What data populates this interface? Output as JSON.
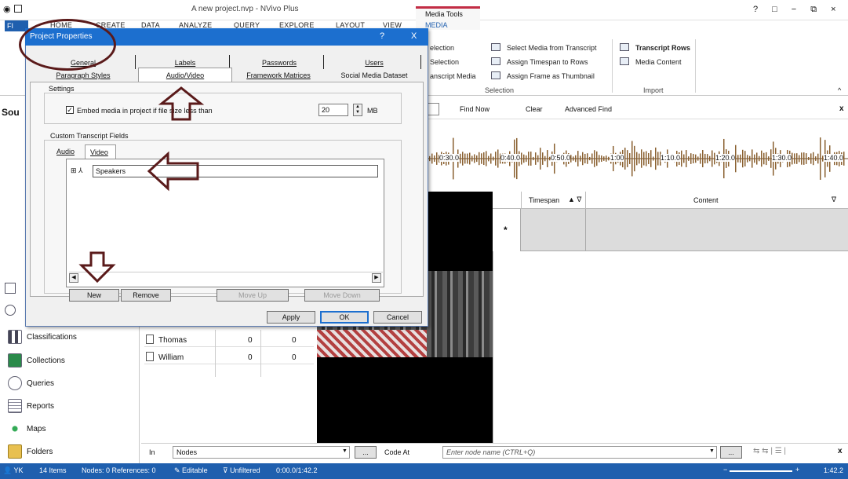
{
  "app": {
    "title": "A new project.nvp - NVivo Plus",
    "window_controls": [
      "?",
      "□",
      "−",
      "⧉",
      "×"
    ]
  },
  "ribbon": {
    "file_tab": "FI",
    "tabs": [
      "HOME",
      "CREATE",
      "DATA",
      "ANALYZE",
      "QUERY",
      "EXPLORE",
      "LAYOUT",
      "VIEW"
    ],
    "contextual_group": "Media Tools",
    "contextual_tab": "MEDIA",
    "selection_items": [
      "election",
      "Selection",
      "anscript Media"
    ],
    "selection_actions": [
      "Select Media from Transcript",
      "Assign Timespan to Rows",
      "Assign Frame as Thumbnail"
    ],
    "selection_group_label": "Selection",
    "import_actions": [
      "Transcript Rows",
      "Media Content"
    ],
    "import_group_label": "Import"
  },
  "find_bar": {
    "find_now": "Find Now",
    "clear": "Clear",
    "advanced_find": "Advanced Find"
  },
  "waveform": {
    "ticks": [
      "0:30.0",
      "0:40.0",
      "0:50.0",
      "1:00",
      "1:10.0",
      "1:20.0",
      "1:30.0",
      "1:40.0"
    ]
  },
  "transcript_grid": {
    "columns": [
      "Timespan",
      "Content"
    ],
    "new_row_marker": "*"
  },
  "left_nav": {
    "header": "Sou",
    "items": [
      {
        "label": "Classifications",
        "icon": "classifications-icon"
      },
      {
        "label": "Collections",
        "icon": "collections-icon"
      },
      {
        "label": "Queries",
        "icon": "queries-icon"
      },
      {
        "label": "Reports",
        "icon": "reports-icon"
      },
      {
        "label": "Maps",
        "icon": "maps-icon"
      },
      {
        "label": "Folders",
        "icon": "folders-icon"
      }
    ]
  },
  "node_list": {
    "rows": [
      {
        "name": "Thomas",
        "a": "0",
        "b": "0"
      },
      {
        "name": "William",
        "a": "0",
        "b": "0"
      }
    ]
  },
  "code_bar": {
    "in_label": "In",
    "in_value": "Nodes",
    "code_at": "Code At",
    "node_placeholder": "Enter node name (CTRL+Q)"
  },
  "status_bar": {
    "user": "YK",
    "items": "14 Items",
    "nodes": "Nodes: 0 References: 0",
    "editable": "Editable",
    "filter": "Unfiltered",
    "time": "0:00.0/1:42.2",
    "end_time": "1:42.2"
  },
  "dialog": {
    "title": "Project Properties",
    "help": "?",
    "close": "X",
    "tabs_row1": [
      "General",
      "Labels",
      "Passwords",
      "Users"
    ],
    "tabs_row2": [
      "Paragraph Styles",
      "Audio/Video",
      "Framework Matrices",
      "Social Media Dataset"
    ],
    "active_tab": "Audio/Video",
    "settings_label": "Settings",
    "embed_checkbox_label": "Embed media in project if file size less than",
    "embed_checked": true,
    "size_value": "20",
    "size_unit": "MB",
    "custom_fields_label": "Custom Transcript Fields",
    "subtabs": [
      "Audio",
      "Video"
    ],
    "active_subtab": "Video",
    "field_row": "Speakers",
    "buttons": {
      "new": "New",
      "remove": "Remove",
      "move_up": "Move Up",
      "move_down": "Move Down",
      "apply": "Apply",
      "ok": "OK",
      "cancel": "Cancel"
    }
  },
  "colors": {
    "accent_blue": "#1f5fae",
    "dialog_title": "#1c6fcf",
    "annotation": "#5a1a1a",
    "media_tools_accent": "#c22c44"
  }
}
